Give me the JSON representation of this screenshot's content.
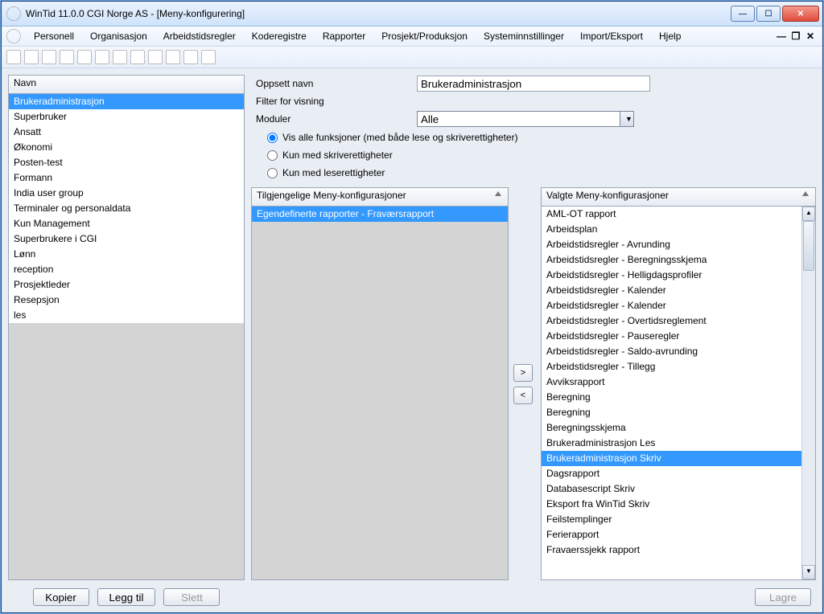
{
  "window": {
    "title": "WinTid 11.0.0 CGI Norge AS - [Meny-konfigurering]"
  },
  "menu": [
    "Personell",
    "Organisasjon",
    "Arbeidstidsregler",
    "Koderegistre",
    "Rapporter",
    "Prosjekt/Produksjon",
    "Systeminnstillinger",
    "Import/Eksport",
    "Hjelp"
  ],
  "left_list": {
    "header": "Navn",
    "items": [
      "Brukeradministrasjon",
      "Superbruker",
      "Ansatt",
      "Økonomi",
      "Posten-test",
      "Formann",
      "India user group",
      "Terminaler og personaldata",
      "Kun Management",
      "Superbrukere i CGI",
      "Lønn",
      "reception",
      "Prosjektleder",
      "Resepsjon",
      "les"
    ],
    "selected": "Brukeradministrasjon"
  },
  "buttons": {
    "copy": "Kopier",
    "add": "Legg til",
    "delete": "Slett",
    "save": "Lagre",
    "move_right": ">",
    "move_left": "<"
  },
  "form": {
    "name_label": "Oppsett navn",
    "name_value": "Brukeradministrasjon",
    "filter_group": "Filter for visning",
    "module_label": "Moduler",
    "module_value": "Alle",
    "radio_all": "Vis alle funksjoner (med både lese og skriverettigheter)",
    "radio_write": "Kun med skriverettigheter",
    "radio_read": "Kun med leserettigheter"
  },
  "available": {
    "header": "Tilgjengelige Meny-konfigurasjoner",
    "items": [
      "Egendefinerte rapporter - Fraværsrapport"
    ],
    "selected": "Egendefinerte rapporter - Fraværsrapport"
  },
  "selected_list": {
    "header": "Valgte Meny-konfigurasjoner",
    "items": [
      "AML-OT rapport",
      "Arbeidsplan",
      "Arbeidstidsregler - Avrunding",
      "Arbeidstidsregler - Beregningsskjema",
      "Arbeidstidsregler - Helligdagsprofiler",
      "Arbeidstidsregler - Kalender",
      "Arbeidstidsregler - Kalender",
      "Arbeidstidsregler - Overtidsreglement",
      "Arbeidstidsregler - Pauseregler",
      "Arbeidstidsregler - Saldo-avrunding",
      "Arbeidstidsregler - Tillegg",
      "Avviksrapport",
      "Beregning",
      "Beregning",
      "Beregningsskjema",
      "Brukeradministrasjon Les",
      "Brukeradministrasjon Skriv",
      "Dagsrapport",
      "Databasescript Skriv",
      "Eksport fra WinTid Skriv",
      "Feilstemplinger",
      "Ferierapport",
      "Fravaerssjekk rapport"
    ],
    "selected": "Brukeradministrasjon Skriv"
  }
}
